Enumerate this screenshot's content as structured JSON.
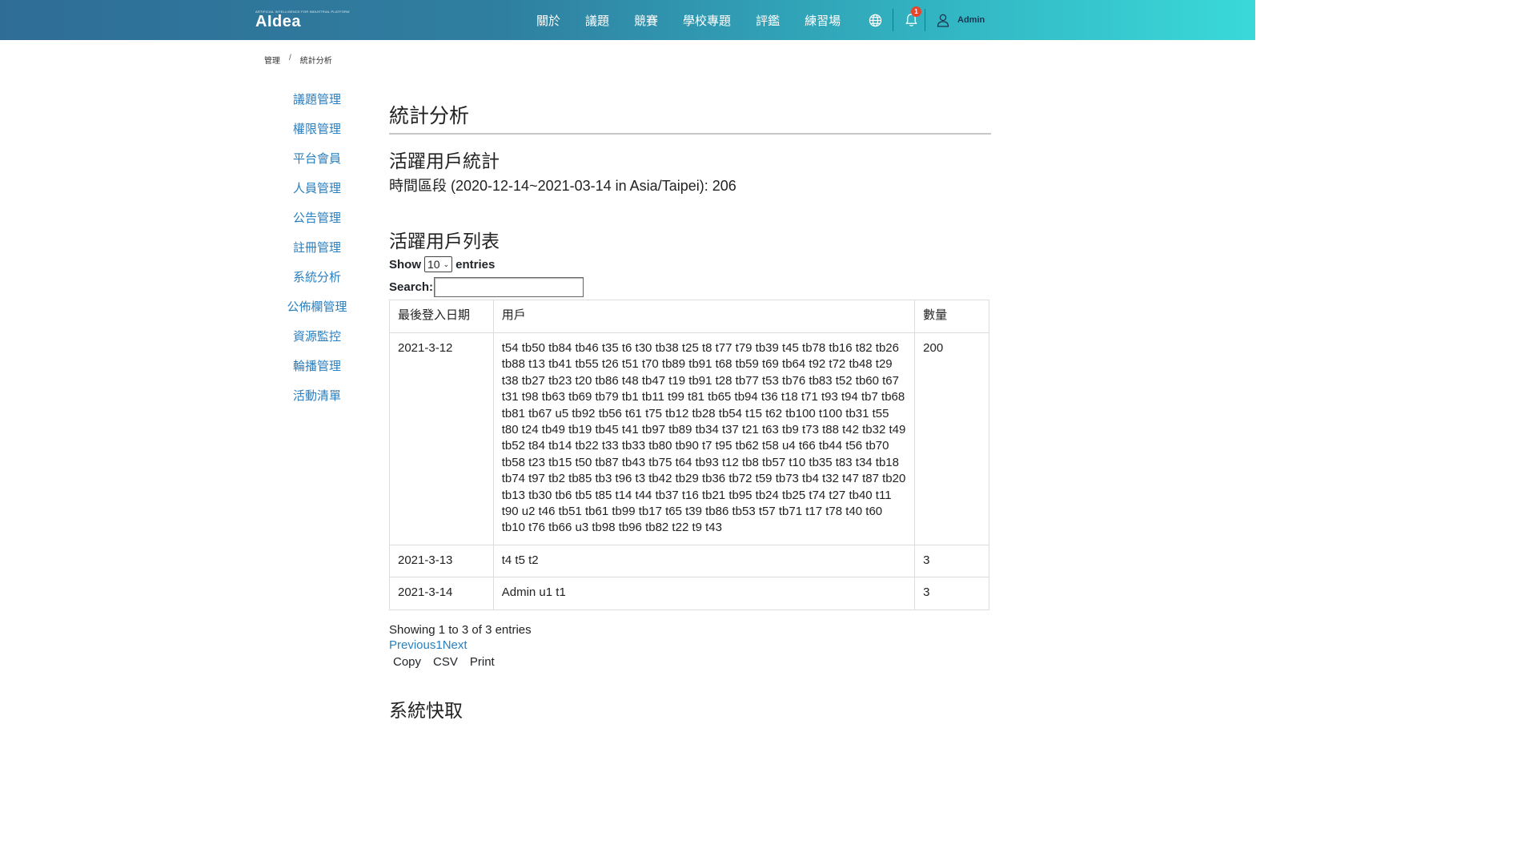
{
  "brand": {
    "name": "AIdea",
    "tagline": "ARTIFICIAL INTELLIGENCE FOR INDUSTRIAL PLATFORM",
    "colors": {
      "navbar_start": "#2f6d96",
      "navbar_end": "#3ad9d9",
      "link": "#2a7fbf"
    }
  },
  "nav": {
    "links": [
      "關於",
      "議題",
      "競賽",
      "學校專題",
      "評鑑",
      "練習場"
    ],
    "icons": {
      "language": "globe-icon",
      "notifications": "bell-icon",
      "user": "user-icon"
    },
    "notification_count": "1",
    "user_name": "Admin"
  },
  "breadcrumb": {
    "items": [
      "管理",
      "統計分析"
    ],
    "separator": "/"
  },
  "sidebar": {
    "items": [
      "議題管理",
      "權限管理",
      "平台會員",
      "人員管理",
      "公告管理",
      "註冊管理",
      "系統分析",
      "公佈欄管理",
      "資源監控",
      "輪播管理",
      "活動清單"
    ]
  },
  "main": {
    "title": "統計分析",
    "active_stats": {
      "heading": "活躍用戶統計",
      "summary": "時間區段 (2020-12-14~2021-03-14 in Asia/Taipei): 206"
    },
    "active_list": {
      "heading": "活躍用戶列表",
      "show_label": "Show",
      "show_value": "10",
      "entries_label": "entries",
      "search_label": "Search:",
      "search_value": "",
      "columns": [
        "最後登入日期",
        "用戶",
        "數量"
      ],
      "rows": [
        {
          "date": "2021-3-12",
          "users": "t54 tb50 tb84 tb46 t35 t6 t30 tb38 t25 t8 t77 t79 tb39 t45 tb78 tb16 t82 tb26 tb88 t13 tb41 tb55 t26 t51 t70 tb89 tb91 t68 tb59 t69 tb64 t92 t72 tb48 t29 t38 tb27 tb23 t20 tb86 t48 tb47 t19 tb91 t28 tb77 t53 tb76 tb83 t52 tb60 t67 t31 t98 tb63 tb69 tb79 tb1 tb11 t99 t81 tb65 tb94 t36 t18 t71 t93 t94 tb7 tb68 tb81 tb67 u5 tb92 tb56 t61 t75 tb12 tb28 tb54 t15 t62 tb100 t100 tb31 t55 t80 t24 tb49 tb19 tb45 t41 tb97 tb89 tb34 t37 t21 t63 tb9 t73 t88 t42 tb32 t49 tb52 t84 tb14 tb22 t33 tb33 tb80 tb90 t7 t95 tb62 t58 u4 t66 tb44 t56 tb70 tb58 t23 tb15 t50 tb87 tb43 tb75 t64 tb93 t12 tb8 tb57 t10 tb35 t83 t34 tb18 tb74 t97 tb2 tb85 tb3 t96 t3 tb42 tb29 tb36 tb72 t59 tb73 tb4 t32 t47 t87 tb20 tb13 tb30 tb6 tb5 t85 t14 t44 tb37 t16 tb21 tb95 tb24 tb25 t74 t27 tb40 t11 t90 u2 t46 tb51 tb61 tb99 tb17 t65 t39 tb86 tb53 t57 tb71 t17 t78 t40 t60 tb10 t76 tb66 u3 tb98 tb96 tb82 t22 t9 t43",
          "count": "200"
        },
        {
          "date": "2021-3-13",
          "users": "t4 t5 t2",
          "count": "3"
        },
        {
          "date": "2021-3-14",
          "users": "Admin u1 t1",
          "count": "3"
        }
      ],
      "info": "Showing 1 to 3 of 3 entries",
      "pagination": {
        "previous": "Previous",
        "page": "1",
        "next": "Next"
      },
      "export_buttons": [
        "Copy",
        "CSV",
        "Print"
      ]
    },
    "next_heading": "系統快取"
  }
}
